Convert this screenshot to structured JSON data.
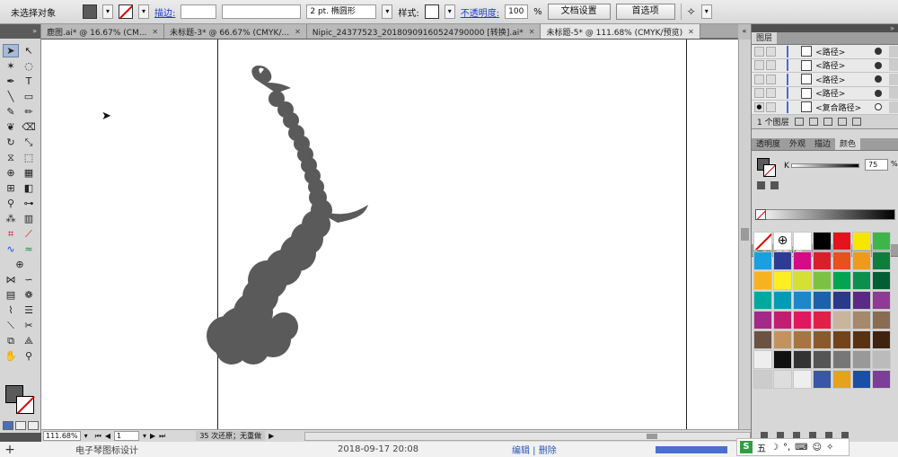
{
  "control_bar": {
    "selection_label": "未选择对象",
    "stroke_label": "描边:",
    "stroke_width_value": "",
    "brush_value": "2 pt. 椭圆形",
    "style_label": "样式:",
    "opacity_label": "不透明度:",
    "opacity_value": "100",
    "opacity_unit": "%",
    "doc_setup_button": "文档设置",
    "preferences_button": "首选项"
  },
  "tabs": [
    {
      "label": "鹿图.ai* @ 16.67% (CM..."
    },
    {
      "label": "未标题-3* @ 66.67% (CMYK/..."
    },
    {
      "label": "Nipic_24377523_20180909160524790000 [转换].ai*"
    },
    {
      "label": "未标题-5* @ 111.68% (CMYK/预览)"
    }
  ],
  "status_bar": {
    "zoom": "111.68%",
    "artboard": "1",
    "history": "35 次还原；无重做"
  },
  "layers_panel": {
    "tab_label": "图层",
    "rows": [
      {
        "name": "<路径>"
      },
      {
        "name": "<路径>"
      },
      {
        "name": "<路径>"
      },
      {
        "name": "<路径>"
      },
      {
        "name": "<复合路径>"
      }
    ],
    "footer_label": "1 个图层"
  },
  "color_panel_tabs": [
    "透明度",
    "外观",
    "描边",
    "颜色"
  ],
  "color_panel": {
    "channel_label": "K",
    "k_value": "75",
    "unit": "%"
  },
  "swatch_panel_tabs": [
    "渐变",
    "色板"
  ],
  "swatches": [
    "#ffffff",
    "#ffffff",
    "#ffffff",
    "#000000",
    "#e3141b",
    "#f6e500",
    "#3db54a",
    "#1a9fe0",
    "#2d3b97",
    "#d40c86",
    "#d7202a",
    "#e8501d",
    "#f09a1b",
    "#0f7e3d",
    "#f8b21f",
    "#fcee21",
    "#d5e035",
    "#7cc242",
    "#00a550",
    "#0b8f4f",
    "#005f35",
    "#00a99d",
    "#009cb5",
    "#1f86c9",
    "#1c61a9",
    "#273b8a",
    "#5b2a86",
    "#8f3b94",
    "#a32a88",
    "#c21f72",
    "#e1185f",
    "#e21f49",
    "#c9b59b",
    "#a6886b",
    "#8a6c53",
    "#6c5243",
    "#c2935f",
    "#a87541",
    "#8a5a2b",
    "#754319",
    "#5a3212",
    "#3f2310",
    "#eeeeee",
    "#111111",
    "#333333",
    "#555555",
    "#777777",
    "#999999",
    "#bbbbbb",
    "#cccccc",
    "#dddddd",
    "#eeeeee",
    "#3a56a8",
    "#e6a21a",
    "#1a4fa8",
    "#7c3e98"
  ],
  "browser_strip": {
    "title": "电子琴图标设计",
    "date": "2018-09-17 20:08",
    "links": "编辑 | 删除"
  },
  "ime": {
    "label": "五"
  }
}
